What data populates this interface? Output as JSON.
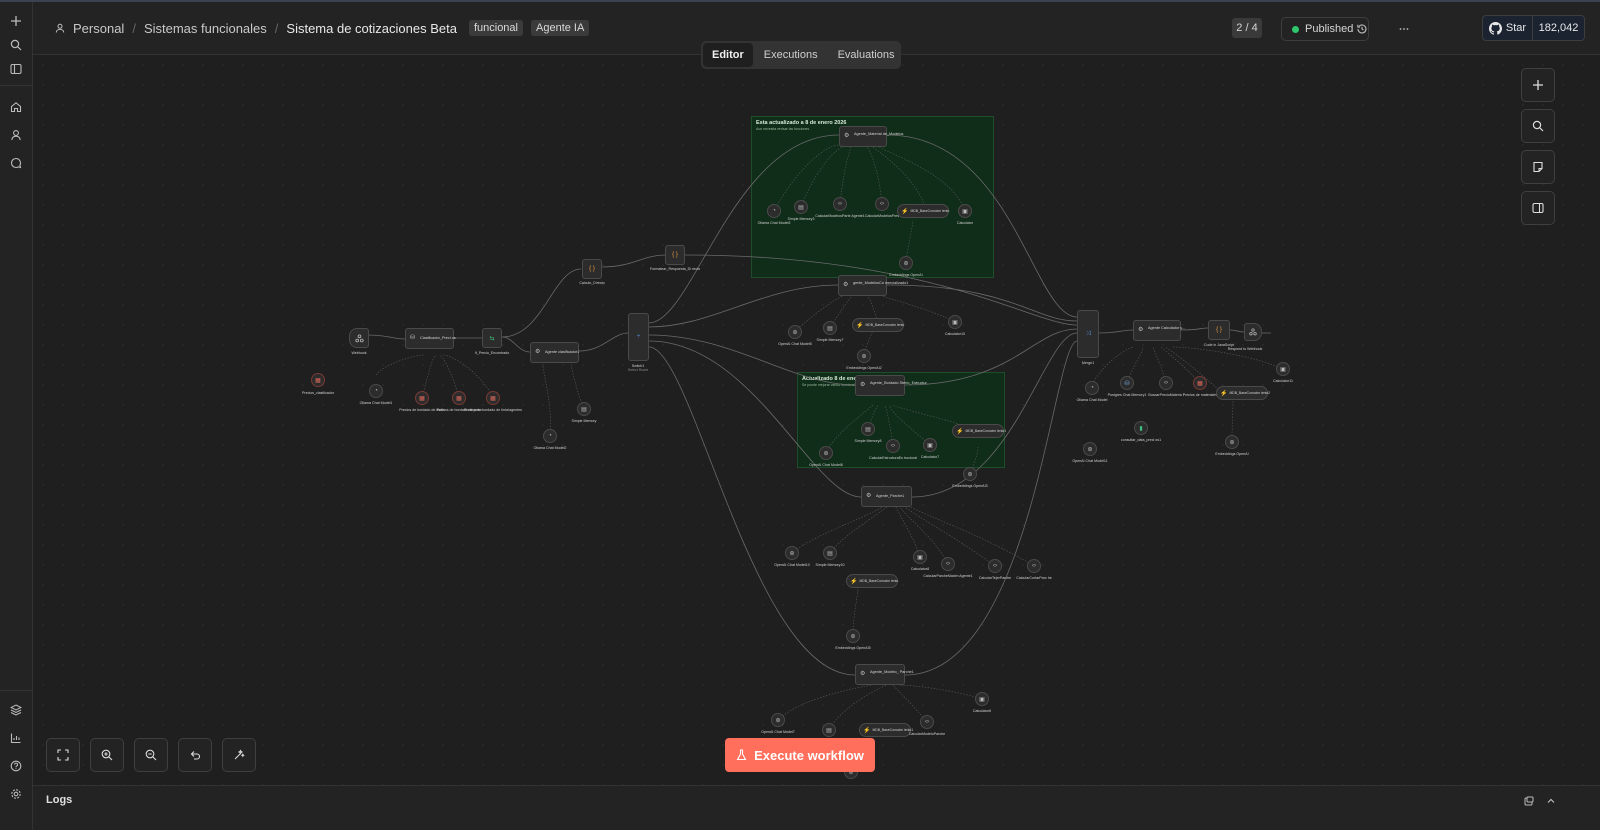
{
  "header": {
    "breadcrumbs": [
      "Personal",
      "Sistemas funcionales",
      "Sistema de cotizaciones Beta"
    ],
    "separator": "/",
    "tags": [
      "funcional",
      "Agente IA"
    ],
    "pager": "2 / 4",
    "status": "Published",
    "github": {
      "star_label": "Star",
      "star_count": "182,042"
    }
  },
  "tabs": [
    "Editor",
    "Executions",
    "Evaluations"
  ],
  "active_tab": "Editor",
  "sticky_notes": {
    "top": {
      "title": "Esta actualizado a 8 de enero 2026",
      "subtitle": "Aun necesita revisar las funciones"
    },
    "middle": {
      "title": "Actualizado 8 de enero",
      "subtitle": "Se puede mejorar varios funcionalidad"
    }
  },
  "nodes": {
    "webhook": "Webhook",
    "precios_clasificador": "Precios_clasificador",
    "clasificador": "Clasificador_Preci os",
    "ollama1": "Ollama Chat Model1",
    "precios_bordado": "Precios de bordado de dsdls",
    "precios_bordado_peso": "Precios de bordado de peso",
    "precios_bordado_cua": "Precios de bordado de tinta/agentes",
    "if_precio": "If_Precio_Encontrado",
    "agente_clasificador": "Agente clasificador1",
    "ollama2": "Ollama Chat Model2",
    "simple_memory": "Simple Memory",
    "calculo_directo": "Calculo_Directo",
    "formatear": "Formatear_Respuesta_Di recto",
    "switch": "Switch1",
    "switch_sub": "Select Route",
    "agente_materia": "Agente_Material de_Modelos",
    "ollama3": "Ollama Chat Model3",
    "simple_memory3": "Simple Memory3",
    "calc_modelos": "CalcularModelosParte Agente1",
    "calc_modelos2": "CalcularModelosPres",
    "mdb1": "MDB_BaseConocim iento",
    "calculator": "Calculator",
    "embeddings1": "Embeddings OpenAI",
    "agente_modelos2": "gente_ModelosCo mercializado1",
    "openai_chat": "OpenAI Chat Model5",
    "simple_memory7": "Simple Memory7",
    "mdb2": "MDB_BaseConocim iento",
    "calculator10": "Calculator10",
    "embeddings2": "Embeddings OpenAI2",
    "agente_bordado": "Agente_Bordado Sterio_Estructur",
    "openai_chat8": "OpenAI Chat Model8",
    "simple_memory8": "Simple Memory8",
    "calc_estructura": "CalcularEstructuraEs tructural",
    "calculator7": "Calculator7",
    "mdb3": "MDB_BaseConocim iento1",
    "embeddings3": "Embeddings OpenAI3",
    "agente_parche": "Agente_Parche1",
    "openai_chat10": "OpenAI Chat Model10",
    "simple_memory10": "Simple Memory10",
    "mdb4": "MDB_BaseConocim iento",
    "calculator8": "Calculator8",
    "calc_parche": "CalcularParcheMaxim Agente1",
    "calc_tejer": "CalcularTejerParche",
    "calc_cortar": "CalcularCortarParc he",
    "embeddings4": "Embeddings OpenAI5",
    "agente_modelo_parche": "Agente_Modelo_ Parche1",
    "openai_chat7": "OpenAI Chat Model7",
    "mdb5": "MDB_BaseConocim iento1",
    "calc_modelo_parche": "CalcularModeloParche",
    "calculator6": "Calculator6",
    "merge": "Merge1",
    "agente_calculador": "Agente Calculador y...",
    "code_js": "Code in JavaScript",
    "respond": "Respond to Webhook",
    "ollama4": "Ollama Chat Model",
    "postgres": "Postgres Chat Memory1",
    "buscar_precio": "BuscarPrecioMateria l",
    "precios_materiales": "Precios de materiales",
    "mdb6": "MDB_BaseConocim iento2",
    "calculator11": "Calculator11",
    "consultar": "consultar_data_preci os1",
    "openai_chat11": "OpenAI Chat Model11",
    "embeddings5": "Embeddings OpenAI"
  },
  "execute_label": "Execute workflow",
  "logs_label": "Logs"
}
